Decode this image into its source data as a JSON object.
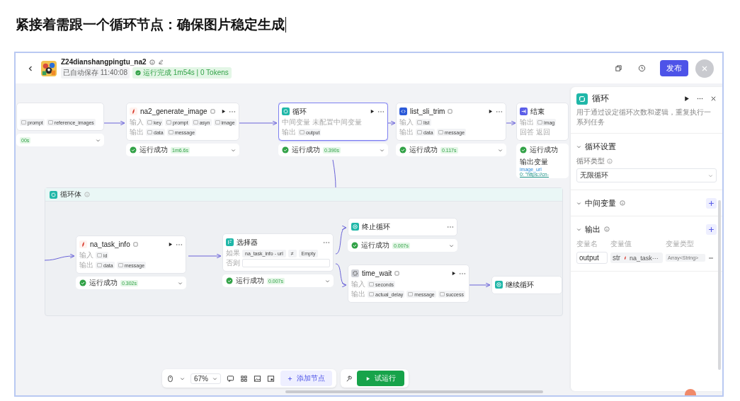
{
  "heading": "紧接着需跟一个循环节点：确保图片稳定生成",
  "header": {
    "title": "Z24dianshangpingtu_na2",
    "save_status": "已自动保存 11:40:08",
    "run_status": "运行完成 1m54s | 0 Tokens",
    "publish_button": "发布"
  },
  "nodes": [
    {
      "kind": "plugin",
      "selected": false,
      "rows": [
        {
          "params": [
            "prompt",
            "reference_images"
          ]
        }
      ],
      "status": {
        "time": "00s"
      }
    },
    {
      "kind": "plugin",
      "title": "na2_generate_image",
      "selected": false,
      "rows": [
        {
          "label": "输入",
          "params": [
            "key",
            "prompt",
            "asyn",
            "image"
          ]
        },
        {
          "label": "输出",
          "params": [
            "data",
            "message"
          ]
        }
      ],
      "status": {
        "text": "运行成功",
        "time": "1m6.6s"
      }
    },
    {
      "kind": "loop",
      "title": "循环",
      "selected": true,
      "rows": [
        {
          "label": "中间变量",
          "note": "未配置中间变量"
        },
        {
          "label": "输出",
          "params": [
            "output"
          ]
        }
      ],
      "status": {
        "text": "运行成功",
        "time": "0.390s"
      }
    },
    {
      "kind": "code",
      "title": "list_sli_trim",
      "selected": false,
      "rows": [
        {
          "label": "输入",
          "params": [
            "list"
          ]
        },
        {
          "label": "输出",
          "params": [
            "data",
            "message"
          ]
        }
      ],
      "status": {
        "text": "运行成功",
        "time": "0.117s"
      }
    },
    {
      "kind": "end",
      "title": "结束",
      "selected": false,
      "rows": [
        {
          "label": "输出",
          "params": [
            "imag"
          ]
        },
        {
          "label": "回答",
          "note": "返回"
        }
      ],
      "status": {
        "text": "运行成功",
        "output_label": "输出变量",
        "output_key": "image_url",
        "output_value": "0: \"https://cn-"
      }
    },
    {
      "kind": "plugin",
      "title": "na_task_info",
      "selected": false,
      "rows": [
        {
          "label": "输入",
          "params": [
            "id"
          ]
        },
        {
          "label": "输出",
          "params": [
            "data",
            "message"
          ]
        }
      ],
      "status": {
        "text": "运行成功",
        "time": "0.302s"
      }
    },
    {
      "kind": "selector",
      "title": "选择器",
      "selected": false,
      "rows": [
        {
          "label": "如果",
          "params": [
            "na_task_info - url",
            "≠",
            "Empty"
          ]
        },
        {
          "label": "否则"
        }
      ],
      "status": {
        "text": "运行成功",
        "time": "0.007s"
      }
    },
    {
      "kind": "break",
      "title": "终止循环",
      "selected": false,
      "status": {
        "text": "运行成功",
        "time": "0.007s"
      }
    },
    {
      "kind": "wait",
      "title": "time_wait",
      "selected": false,
      "rows": [
        {
          "label": "输入",
          "params": [
            "seconds"
          ]
        },
        {
          "label": "输出",
          "params": [
            "actual_delay",
            "message",
            "success"
          ]
        }
      ]
    },
    {
      "kind": "continue",
      "title": "继续循环",
      "selected": false
    }
  ],
  "loop_body": {
    "title": "循环体"
  },
  "panel": {
    "title": "循环",
    "description": "用于通过设定循环次数和逻辑，重复执行一系列任务",
    "sections": [
      {
        "kind": "settings",
        "title": "循环设置",
        "expanded": true,
        "field_label": "循环类型",
        "field_value": "无限循环"
      },
      {
        "kind": "variables",
        "title": "中间变量",
        "expanded": true
      },
      {
        "kind": "outputs",
        "title": "输出",
        "expanded": true,
        "columns": [
          "变量名",
          "变量值",
          "变量类型"
        ],
        "rows": [
          {
            "name": "output",
            "source_type": "str",
            "source": "na_task···",
            "type": "Array<String>"
          }
        ]
      }
    ]
  },
  "toolbar": {
    "zoom": "67%",
    "add_node": "添加节点",
    "test_run": "试运行"
  }
}
